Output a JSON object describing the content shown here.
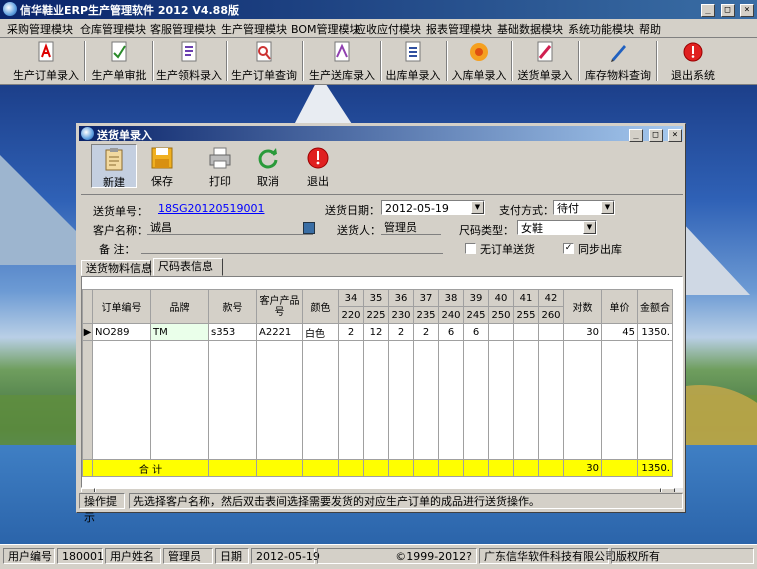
{
  "app": {
    "title": "信华鞋业ERP生产管理软件  2012  V4.88版",
    "window_buttons": [
      "_",
      "□",
      "×"
    ]
  },
  "menu": [
    "采购管理模块",
    "仓库管理模块",
    "客服管理模块",
    "生产管理模块",
    "BOM管理模块",
    "应收应付模块",
    "报表管理模块",
    "基础数据模块",
    "系统功能模块",
    "帮助"
  ],
  "toolbar": [
    {
      "label": "生产订单录入",
      "icon": "pdf-document-icon"
    },
    {
      "label": "生产单审批",
      "icon": "approve-document-icon"
    },
    {
      "label": "生产领料录入",
      "icon": "material-document-icon"
    },
    {
      "label": "生产订单查询",
      "icon": "search-document-icon"
    },
    {
      "label": "生产送库录入",
      "icon": "delivery-document-icon"
    },
    {
      "label": "出库单录入",
      "icon": "outbound-document-icon"
    },
    {
      "label": "入库单录入",
      "icon": "inbound-flower-icon"
    },
    {
      "label": "送货单录入",
      "icon": "shipping-document-icon"
    },
    {
      "label": "库存物料查询",
      "icon": "pen-icon"
    },
    {
      "label": "退出系统",
      "icon": "exit-icon"
    }
  ],
  "dialog": {
    "title": "送货单录入",
    "window_buttons": [
      "_",
      "□",
      "×"
    ],
    "toolbar": [
      {
        "label": "新建",
        "icon": "new-clipboard-icon"
      },
      {
        "label": "保存",
        "icon": "save-floppy-icon"
      },
      {
        "label": "打印",
        "icon": "printer-icon"
      },
      {
        "label": "取消",
        "icon": "cancel-refresh-icon"
      },
      {
        "label": "退出",
        "icon": "exit-icon"
      }
    ],
    "form": {
      "delivery_no_label": "送货单号：",
      "delivery_no": "18SG20120519001",
      "delivery_date_label": "送货日期：",
      "delivery_date": "2012-05-19",
      "payment_label": "支付方式：",
      "payment": "待付",
      "customer_label": "客户名称：",
      "customer": "诚昌",
      "deliverer_label": "送货人：",
      "deliverer": "管理员",
      "size_type_label": "尺码类型：",
      "size_type": "女鞋",
      "remark_label": "备 注：",
      "remark": "",
      "no_order_label": "无订单送货",
      "no_order_checked": false,
      "sync_out_label": "同步出库",
      "sync_out_checked": true
    },
    "tabs": [
      "送货物料信息",
      "尺码表信息"
    ],
    "grid": {
      "headers": [
        "订单编号",
        "品牌",
        "款号",
        "客户产品号",
        "颜色"
      ],
      "size_top": [
        "34",
        "35",
        "36",
        "37",
        "38",
        "39",
        "40",
        "41",
        "42"
      ],
      "size_bottom": [
        "220",
        "225",
        "230",
        "235",
        "240",
        "245",
        "250",
        "255",
        "260"
      ],
      "tail_headers": [
        "对数",
        "单价",
        "金额合"
      ],
      "row": {
        "order_no": "NO289",
        "brand": "TM",
        "style": "s353",
        "cust_product": "A2221",
        "color": "白色",
        "sizes": [
          "2",
          "12",
          "2",
          "2",
          "6",
          "6",
          "",
          "",
          ""
        ],
        "pairs": "30",
        "price": "45",
        "amount": "1350."
      },
      "total": {
        "label": "合 计",
        "pairs": "30",
        "amount": "1350."
      }
    },
    "hint_label": "操作提示",
    "hint_text": "先选择客户名称，然后双击表间选择需要发货的对应生产订单的成品进行送货操作。"
  },
  "status": {
    "user_no_label": "用户编号",
    "user_no": "180001",
    "user_name_label": "用户姓名",
    "user_name": "管理员",
    "date_label": "日期",
    "date": "2012-05-19",
    "copyright": "©1999-2012?",
    "company": "广东信华软件科技有限公司",
    "rights": "版权所有"
  }
}
